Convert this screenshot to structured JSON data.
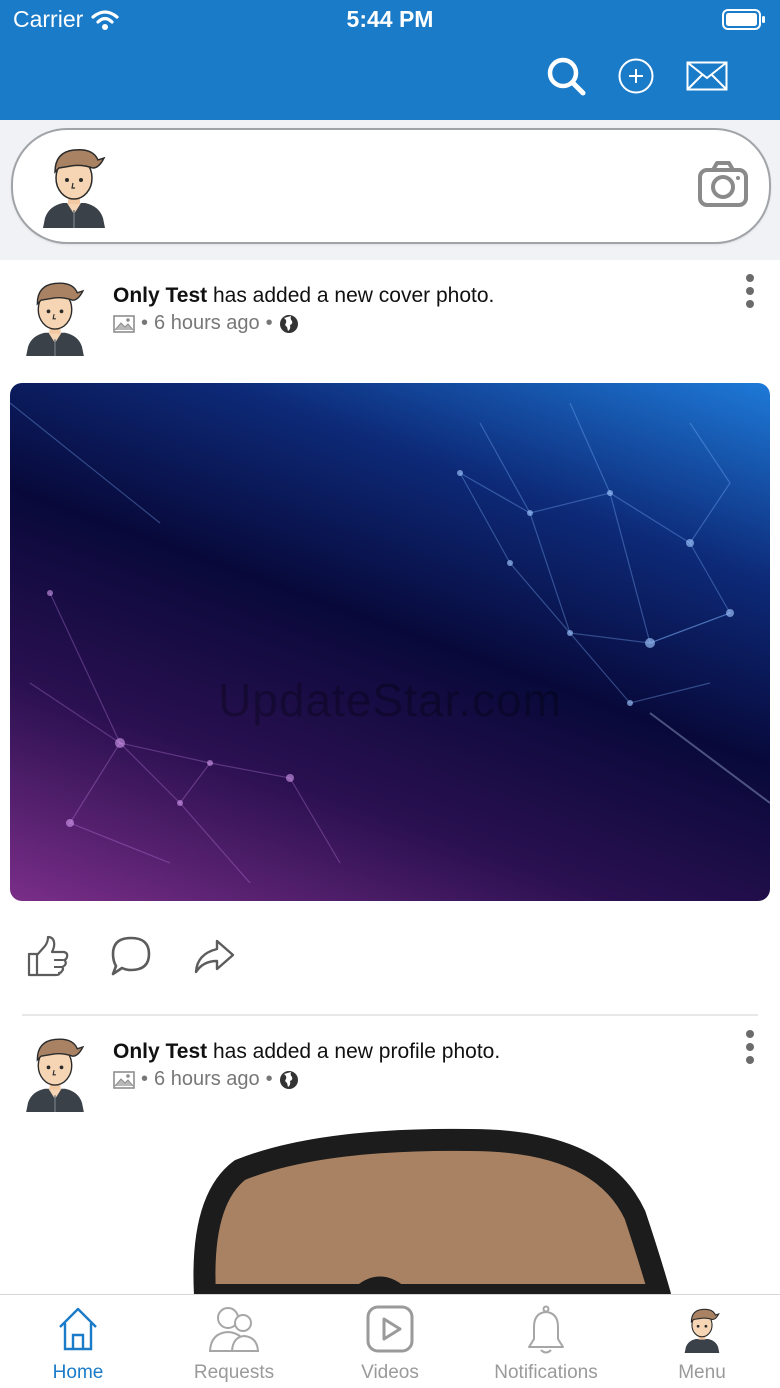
{
  "status_bar": {
    "carrier": "Carrier",
    "time": "5:44 PM"
  },
  "header": {
    "icons": [
      "search-icon",
      "add-circle-icon",
      "mail-icon"
    ],
    "accent_color": "#1a7bc9"
  },
  "composer": {
    "icons": [
      "avatar",
      "camera-icon"
    ]
  },
  "posts": [
    {
      "author": "Only Test",
      "action": " has added a new cover photo.",
      "time": "6 hours ago",
      "separator": "•",
      "privacy_icon": "globe-icon",
      "type_icon": "image-icon",
      "image_watermark": "UpdateStar.com"
    },
    {
      "author": "Only Test",
      "action": " has added a new profile photo.",
      "time": "6 hours ago",
      "separator": "•",
      "privacy_icon": "globe-icon",
      "type_icon": "image-icon"
    }
  ],
  "reactions": [
    "like-icon",
    "comment-icon",
    "share-icon"
  ],
  "tabs": [
    {
      "label": "Home",
      "icon": "home-icon",
      "active": true
    },
    {
      "label": "Requests",
      "icon": "friends-icon",
      "active": false
    },
    {
      "label": "Videos",
      "icon": "video-icon",
      "active": false
    },
    {
      "label": "Notifications",
      "icon": "bell-icon",
      "active": false
    },
    {
      "label": "Menu",
      "icon": "avatar",
      "active": false
    }
  ]
}
